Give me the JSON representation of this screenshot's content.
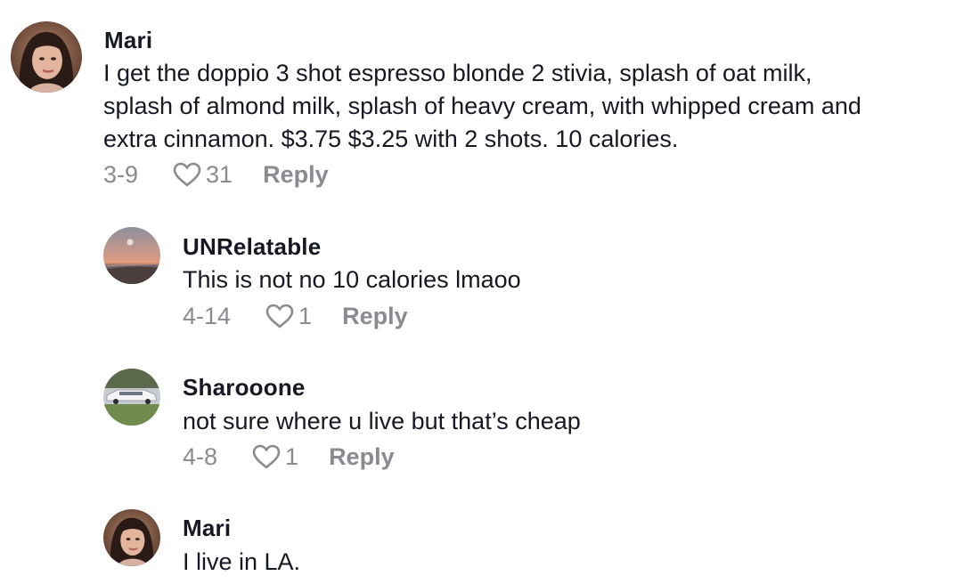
{
  "comments": [
    {
      "username": "Mari",
      "text": "I get the doppio 3 shot espresso blonde 2 stivia, splash of oat milk,\nsplash of almond milk, splash of heavy cream, with whipped cream and\nextra cinnamon. $3.75 $3.25 with 2 shots. 10 calories.",
      "date": "3-9",
      "likes": "31",
      "reply_label": "Reply",
      "avatar": "woman-portrait-avatar"
    },
    {
      "username": "UNRelatable",
      "text": "This is not no 10 calories lmaoo",
      "date": "4-14",
      "likes": "1",
      "reply_label": "Reply",
      "avatar": "sunset-ocean-avatar"
    },
    {
      "username": "Sharooone",
      "text": "not sure where u live but that’s cheap",
      "date": "4-8",
      "likes": "1",
      "reply_label": "Reply",
      "avatar": "white-limousine-avatar"
    },
    {
      "username": "Mari",
      "text": "I live in LA.",
      "avatar": "woman-portrait-avatar"
    }
  ],
  "colors": {
    "primary_text": "#161823",
    "secondary_text": "#8a8b91",
    "background": "#ffffff"
  },
  "icons": {
    "like": "heart-outline-icon"
  }
}
